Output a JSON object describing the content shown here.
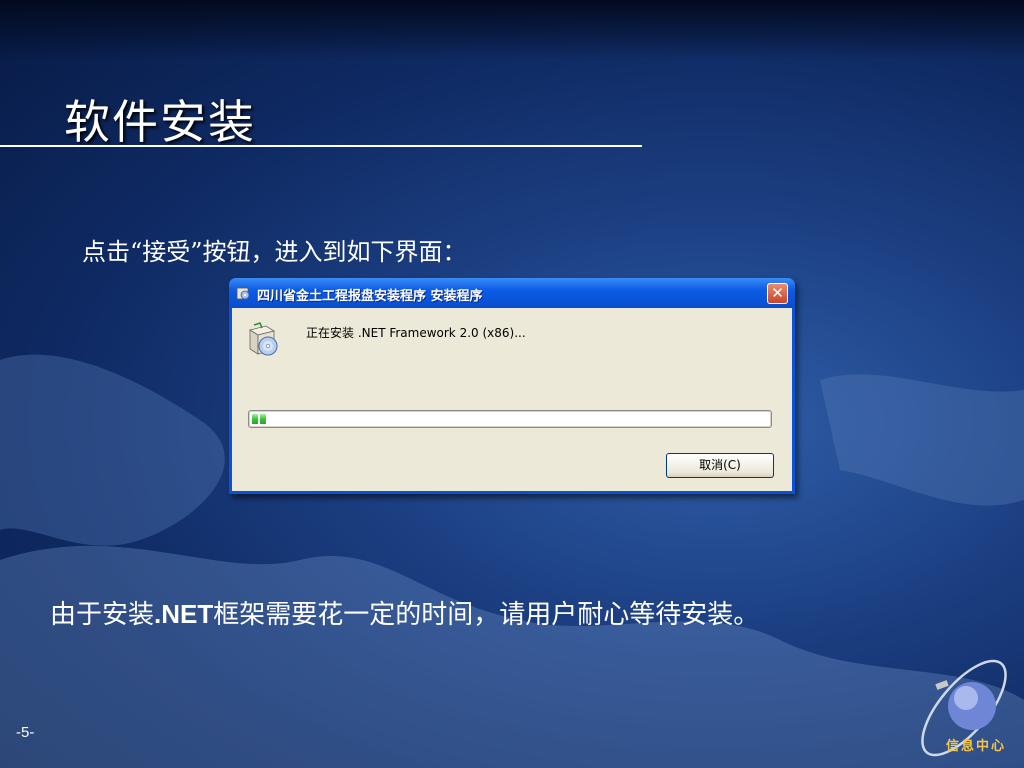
{
  "slide": {
    "title": "软件安装",
    "instruction": "点击“接受”按钮，进入到如下界面：",
    "note_prefix": "由于安装",
    "note_bold": ".NET",
    "note_suffix": "框架需要花一定的时间，请用户耐心等待安装。",
    "page_number": "-5-",
    "logo_text": "信息中心"
  },
  "dialog": {
    "title": "四川省金土工程报盘安装程序 安装程序",
    "close_glyph": "✕",
    "status_text": "正在安装 .NET Framework 2.0 (x86)...",
    "progress": 0.04,
    "cancel_label": "取消(C)"
  },
  "colors": {
    "titlebar": "#0a53d8",
    "client_bg": "#ece9d8",
    "progress_fill": "#3ac43a",
    "logo_text": "#f3c64a"
  },
  "icons": {
    "titlebar": "installer-icon",
    "app": "installer-box-icon",
    "close": "close-icon",
    "logo": "globe-orbit-logo"
  }
}
